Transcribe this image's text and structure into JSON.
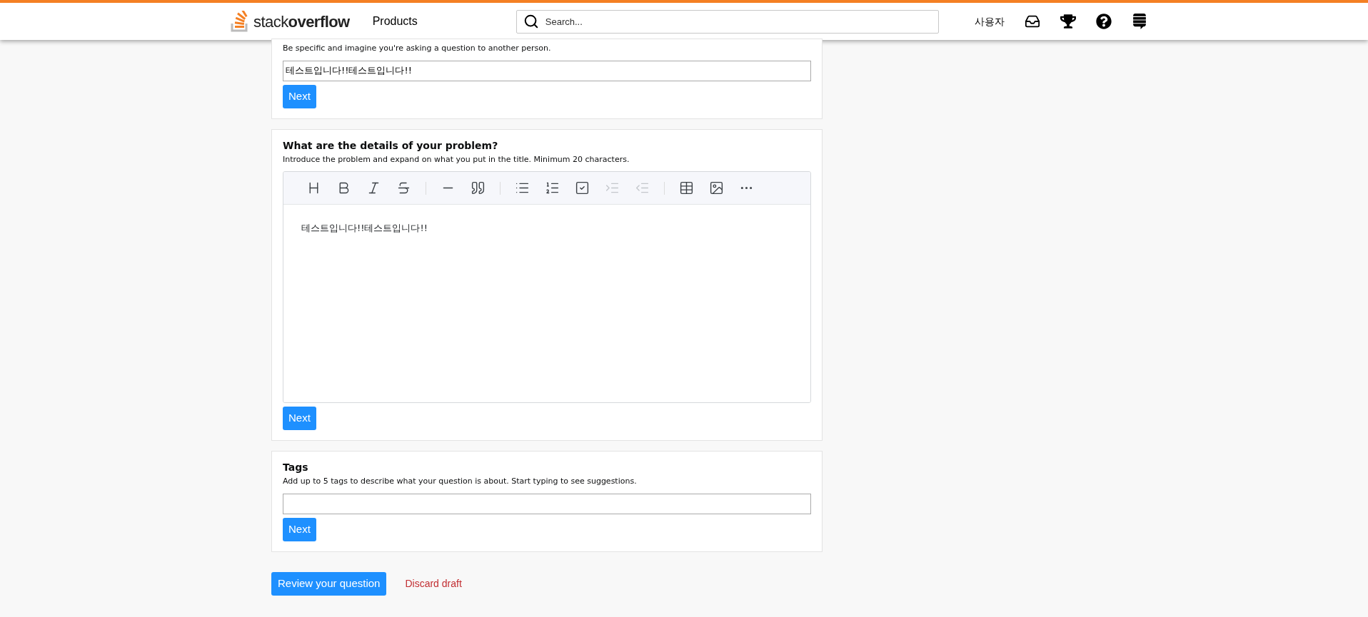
{
  "header": {
    "logo": "stack**overflow**",
    "nav": [
      "Products"
    ],
    "search": {
      "placeholder": "Search..."
    },
    "user": "사용자",
    "icons": [
      {
        "kind": "inbox"
      },
      {
        "kind": "trophy"
      },
      {
        "kind": "help"
      },
      {
        "kind": "sites"
      }
    ]
  },
  "sections": [
    {
      "kind": "title",
      "subtitle": "Be specific and imagine you're asking a question to another person.",
      "value": "테스트입니다!!테스트입니다!!",
      "button": "Next"
    },
    {
      "kind": "editor",
      "heading": "What are the details of your problem?",
      "subtitle": "Introduce the problem and expand on what you put in the title. Minimum 20 characters.",
      "toolbar": [
        [
          {
            "kind": "heading",
            "disabled": false
          },
          {
            "kind": "bold",
            "disabled": false
          },
          {
            "kind": "italic",
            "disabled": false
          },
          {
            "kind": "strike",
            "disabled": false
          }
        ],
        [
          {
            "kind": "rule",
            "disabled": false
          },
          {
            "kind": "quote",
            "disabled": false
          }
        ],
        [
          {
            "kind": "bullets",
            "disabled": false
          },
          {
            "kind": "numbers",
            "disabled": false
          },
          {
            "kind": "task",
            "disabled": false
          },
          {
            "kind": "indent",
            "disabled": true
          },
          {
            "kind": "outdent",
            "disabled": true
          }
        ],
        [
          {
            "kind": "table",
            "disabled": false
          },
          {
            "kind": "image",
            "disabled": false
          },
          {
            "kind": "more",
            "disabled": false
          }
        ]
      ],
      "value": "테스트입니다!!테스트입니다!!",
      "button": "Next"
    },
    {
      "kind": "tags",
      "heading": "Tags",
      "subtitle": "Add up to 5 tags to describe what your question is about. Start typing to see suggestions.",
      "button": "Next"
    }
  ],
  "actions": {
    "review": "Review your question",
    "discard": "Discard draft"
  }
}
